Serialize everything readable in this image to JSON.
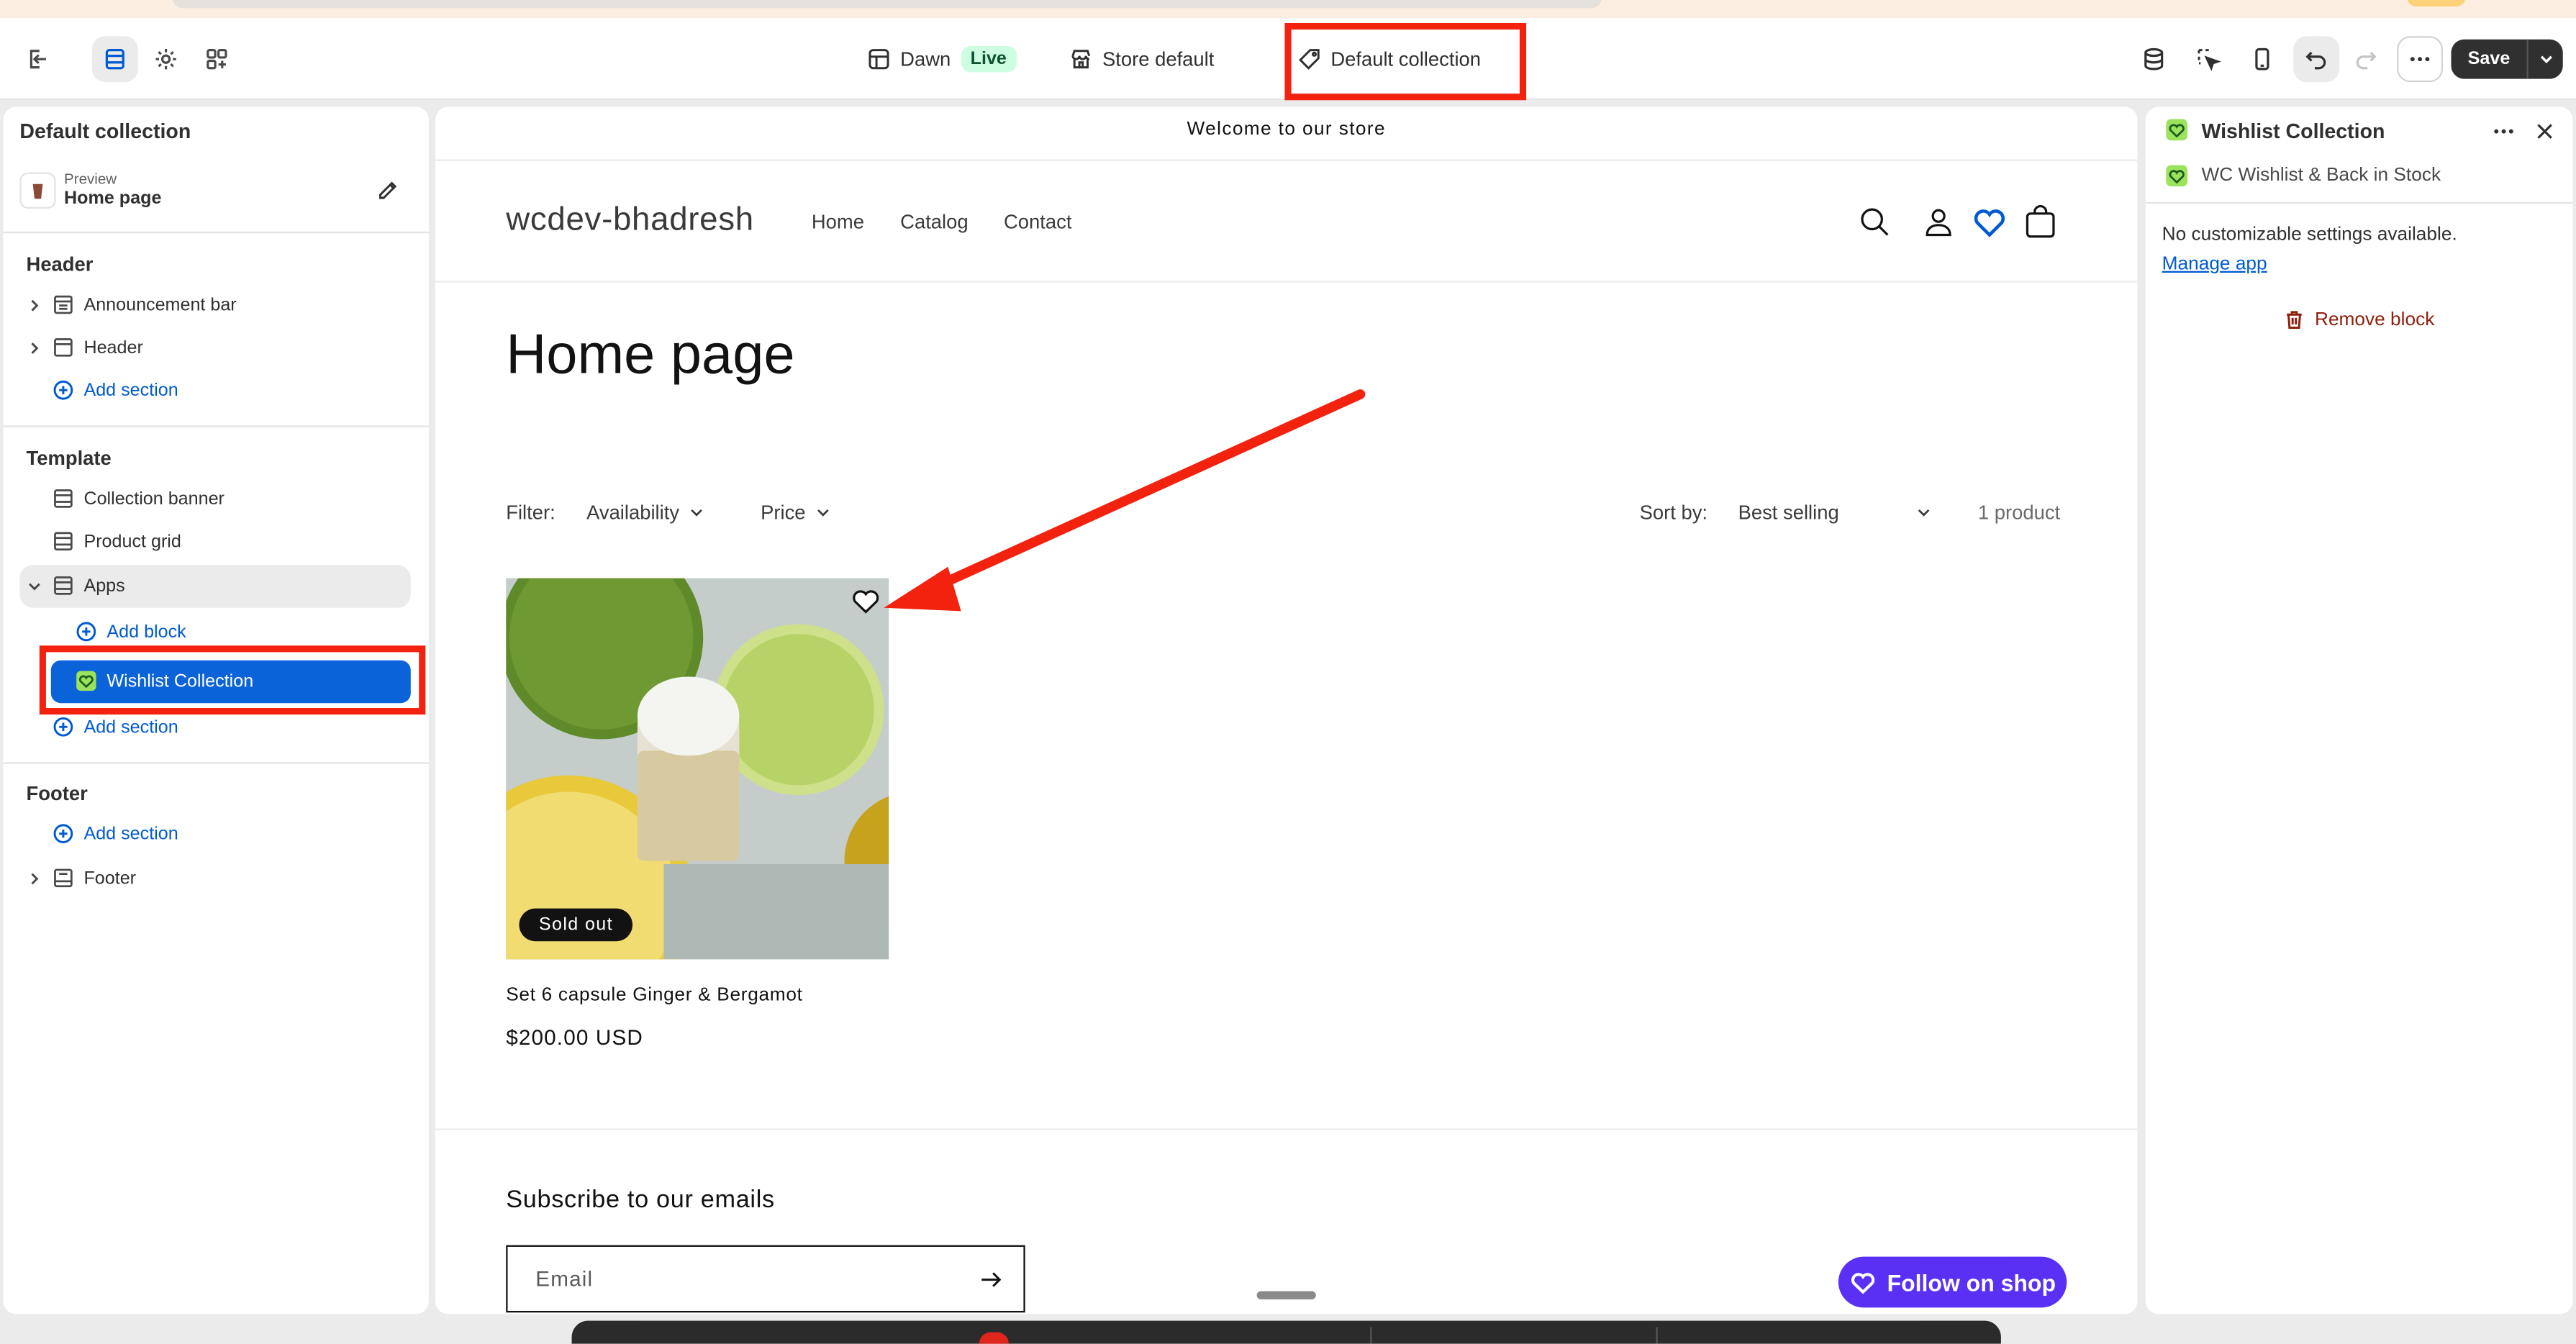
{
  "topbar": {
    "theme_name": "Dawn",
    "theme_status": "Live",
    "store_label": "Store default",
    "template_label": "Default collection",
    "save_label": "Save"
  },
  "left_panel": {
    "title": "Default collection",
    "preview_caption": "Preview",
    "preview_page": "Home page",
    "header_group": "Header",
    "header_items": [
      "Announcement bar",
      "Header"
    ],
    "add_section": "Add section",
    "template_group": "Template",
    "template_items": [
      "Collection banner",
      "Product grid",
      "Apps"
    ],
    "add_block": "Add block",
    "selected_block": "Wishlist Collection",
    "footer_group": "Footer",
    "footer_items": [
      "Footer"
    ]
  },
  "store": {
    "announcement": "Welcome to our store",
    "logo": "wcdev-bhadresh",
    "nav": [
      "Home",
      "Catalog",
      "Contact"
    ],
    "page_title": "Home page",
    "filter_label": "Filter:",
    "filter_availability": "Availability",
    "filter_price": "Price",
    "sort_label": "Sort by:",
    "sort_value": "Best selling",
    "product_count": "1 product",
    "product": {
      "badge": "Sold out",
      "name": "Set 6 capsule Ginger & Bergamot",
      "price": "$200.00 USD"
    },
    "newsletter_title": "Subscribe to our emails",
    "email_placeholder": "Email",
    "follow_label": "Follow on shop"
  },
  "right_panel": {
    "title": "Wishlist Collection",
    "app_name": "WC Wishlist & Back in Stock",
    "message": "No customizable settings available.",
    "manage_link": "Manage app",
    "remove_label": "Remove block"
  },
  "colors": {
    "accent_blue": "#005bd3",
    "selection_blue": "#0b63d9",
    "highlight_red": "#f2220f",
    "shop_purple": "#5a31f4",
    "remove_red": "#8e1f0b"
  }
}
